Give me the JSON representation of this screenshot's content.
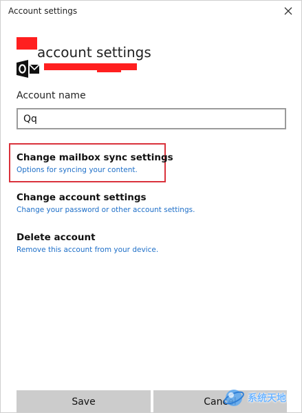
{
  "window": {
    "title": "Account settings"
  },
  "header": {
    "heading": "account settings",
    "account_icon": "outlook-icon"
  },
  "account_name": {
    "label": "Account name",
    "value": "Qq"
  },
  "options": [
    {
      "title": "Change mailbox sync settings",
      "description": "Options for syncing your content."
    },
    {
      "title": "Change account settings",
      "description": "Change your password or other account settings."
    },
    {
      "title": "Delete account",
      "description": "Remove this account from your device."
    }
  ],
  "buttons": {
    "save": "Save",
    "cancel": "Cancel"
  },
  "watermark": {
    "text": "系统天地"
  },
  "colors": {
    "link": "#1e6fc8",
    "highlight_border": "#d9303a",
    "redaction": "#ff1f1f",
    "button_bg": "#cccccc"
  }
}
